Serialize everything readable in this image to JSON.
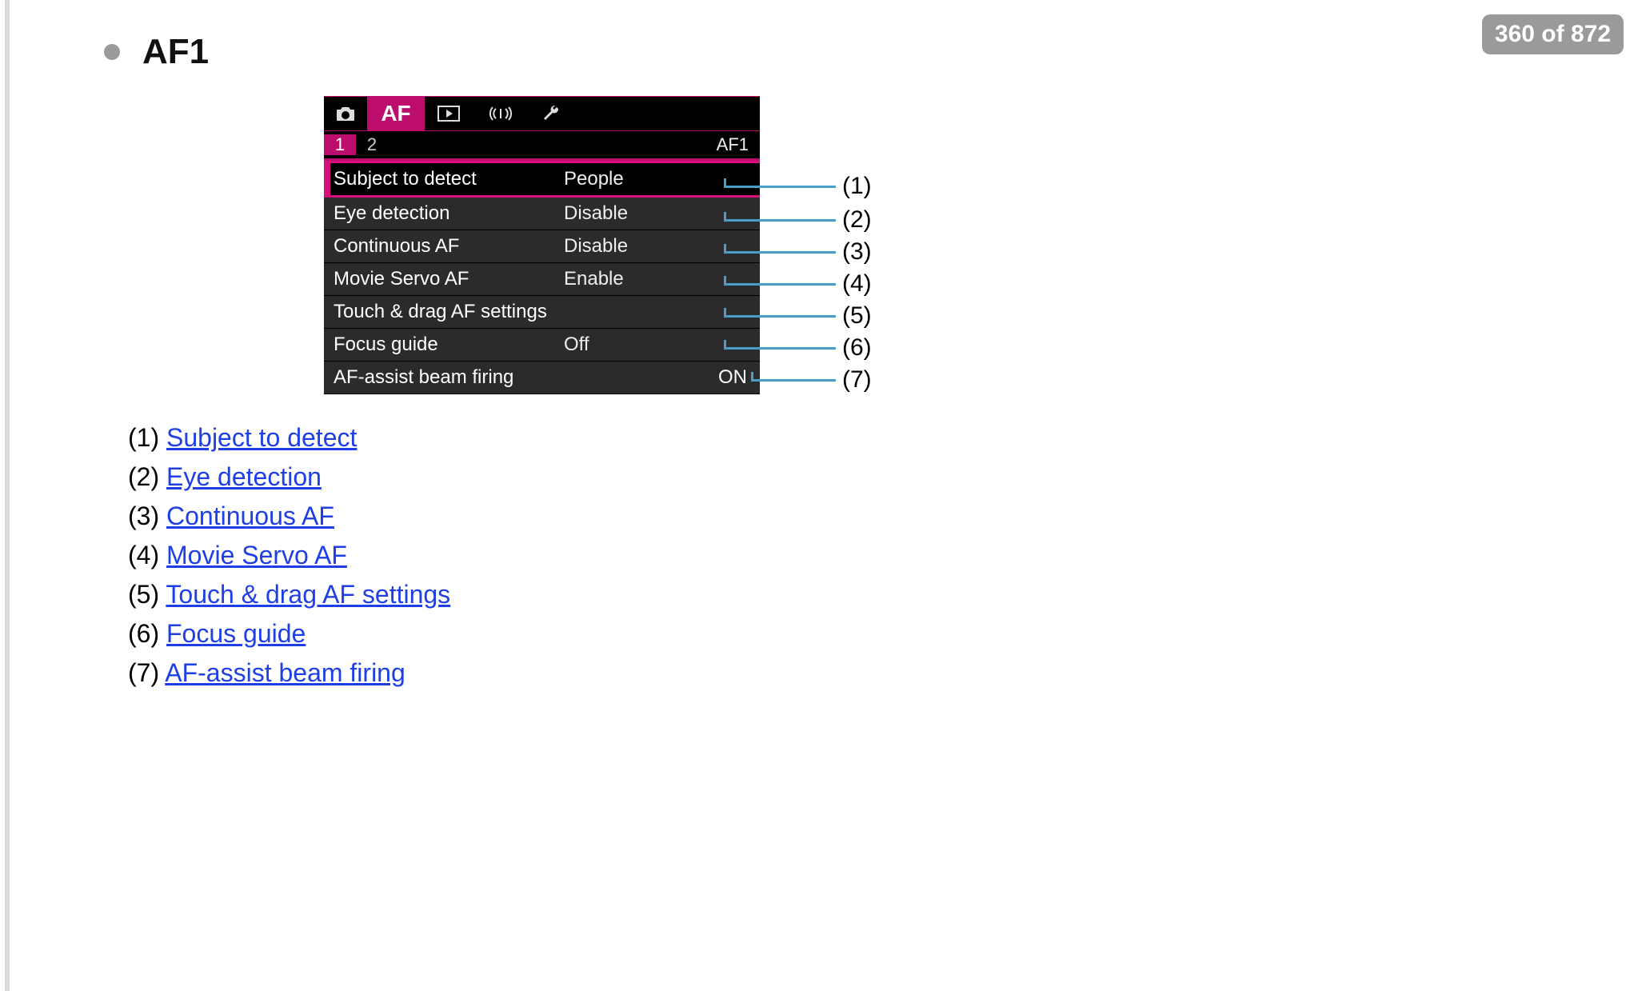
{
  "page_indicator": "360 of 872",
  "section_title": "AF1",
  "lcd": {
    "top_tab_label": "AF",
    "sub_tabs": [
      "1",
      "2"
    ],
    "sub_right": "AF1",
    "rows": [
      {
        "label": "Subject to detect",
        "value": "People",
        "selected": true
      },
      {
        "label": "Eye detection",
        "value": "Disable",
        "selected": false
      },
      {
        "label": "Continuous AF",
        "value": "Disable",
        "selected": false
      },
      {
        "label": "Movie Servo AF",
        "value": "Enable",
        "selected": false
      },
      {
        "label": "Touch & drag AF settings",
        "value": "",
        "selected": false
      },
      {
        "label": "Focus guide",
        "value": "Off",
        "selected": false
      },
      {
        "label": "AF-assist beam firing",
        "value_right": "ON",
        "selected": false
      }
    ]
  },
  "callouts": [
    "(1)",
    "(2)",
    "(3)",
    "(4)",
    "(5)",
    "(6)",
    "(7)"
  ],
  "links": [
    {
      "num": "(1)",
      "text": "Subject to detect"
    },
    {
      "num": "(2)",
      "text": "Eye detection"
    },
    {
      "num": "(3)",
      "text": "Continuous AF"
    },
    {
      "num": "(4)",
      "text": "Movie Servo AF"
    },
    {
      "num": "(5)",
      "text": "Touch & drag AF settings"
    },
    {
      "num": "(6)",
      "text": "Focus guide"
    },
    {
      "num": "(7)",
      "text": "AF-assist beam firing"
    }
  ]
}
